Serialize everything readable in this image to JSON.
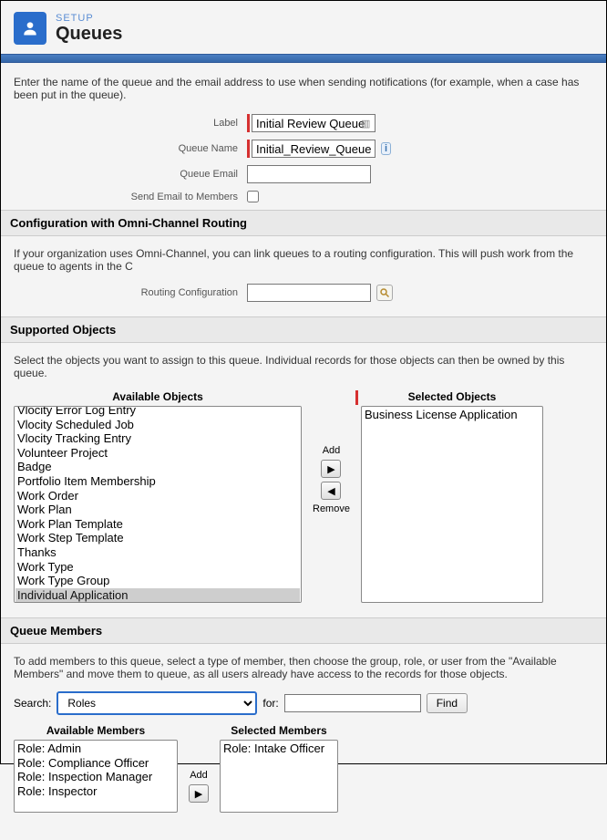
{
  "header": {
    "setup": "SETUP",
    "title": "Queues"
  },
  "intro": "Enter the name of the queue and the email address to use when sending notifications (for example, when a case has been put in the queue).",
  "form": {
    "label_label": "Label",
    "label_value": "Initial Review Queue",
    "queuename_label": "Queue Name",
    "queuename_value": "Initial_Review_Queue",
    "queueemail_label": "Queue Email",
    "queueemail_value": "",
    "sendmail_label": "Send Email to Members"
  },
  "omni": {
    "header": "Configuration with Omni-Channel Routing",
    "desc": "If your organization uses Omni-Channel, you can link queues to a routing configuration. This will push work from the queue to agents in the C",
    "routing_label": "Routing Configuration",
    "routing_value": ""
  },
  "supported": {
    "header": "Supported Objects",
    "desc": "Select the objects you want to assign to this queue. Individual records for those objects can then be owned by this queue.",
    "available_label": "Available Objects",
    "selected_label": "Selected Objects",
    "add_label": "Add",
    "remove_label": "Remove",
    "available": [
      "Vlocity Error Log Entry",
      "Vlocity Scheduled Job",
      "Vlocity Tracking Entry",
      "Volunteer Project",
      "Badge",
      "Portfolio Item Membership",
      "Work Order",
      "Work Plan",
      "Work Plan Template",
      "Work Step Template",
      "Thanks",
      "Work Type",
      "Work Type Group",
      "Individual Application"
    ],
    "selected": [
      "Business License Application"
    ]
  },
  "members": {
    "header": "Queue Members",
    "desc": "To add members to this queue, select a type of member, then choose the group, role, or user from the \"Available Members\" and move them to queue, as all users already have access to the records for those objects.",
    "search_label": "Search:",
    "dropdown": "Roles",
    "for_label": "for:",
    "for_value": "",
    "find_label": "Find",
    "available_label": "Available Members",
    "selected_label": "Selected Members",
    "add_label": "Add",
    "available": [
      "Role: Admin",
      "Role: Compliance Officer",
      "Role: Inspection Manager",
      "Role: Inspector"
    ],
    "selected": [
      "Role: Intake Officer"
    ]
  }
}
